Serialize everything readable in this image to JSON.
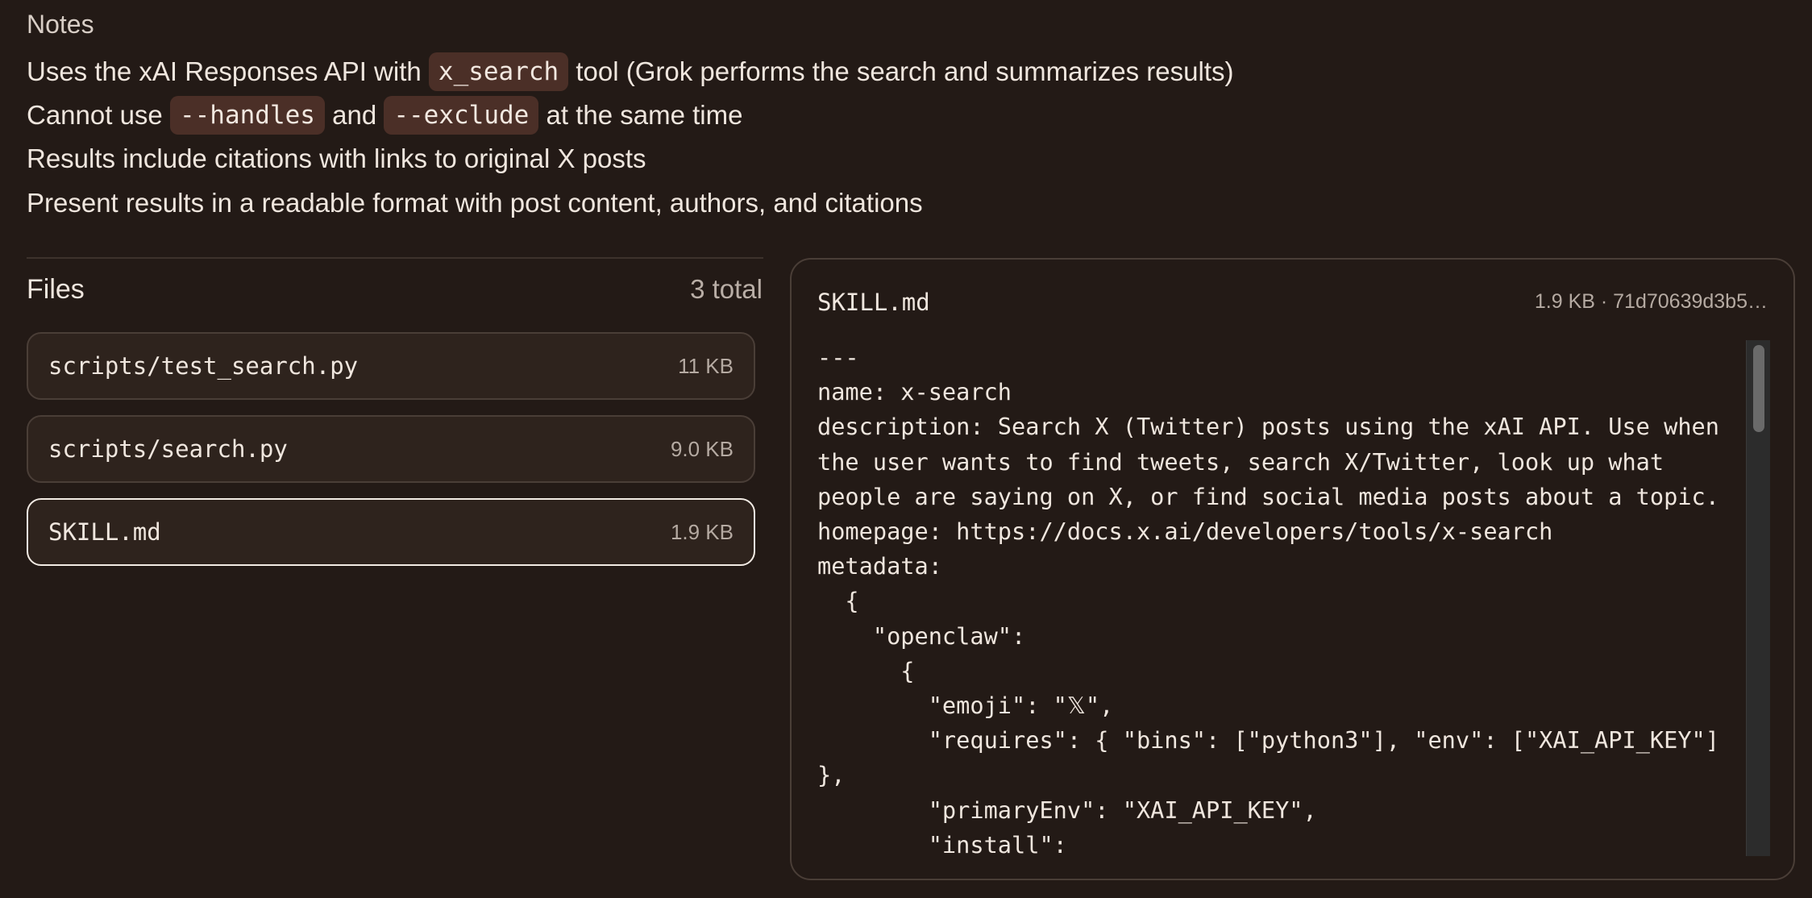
{
  "notes": {
    "title": "Notes",
    "line1": {
      "pre": "Uses the xAI Responses API with ",
      "code": "x_search",
      "post": " tool (Grok performs the search and summarizes results)"
    },
    "line2": {
      "pre": "Cannot use ",
      "code1": "--handles",
      "mid": " and ",
      "code2": "--exclude",
      "post": " at the same time"
    },
    "line3": "Results include citations with links to original X posts",
    "line4": "Present results in a readable format with post content, authors, and citations"
  },
  "files": {
    "title": "Files",
    "count": "3 total",
    "items": [
      {
        "name": "scripts/test_search.py",
        "size": "11 KB"
      },
      {
        "name": "scripts/search.py",
        "size": "9.0 KB"
      },
      {
        "name": "SKILL.md",
        "size": "1.9 KB"
      }
    ]
  },
  "viewer": {
    "filename": "SKILL.md",
    "meta": "1.9 KB · 71d70639d3b5…",
    "content": "---\nname: x-search\ndescription: Search X (Twitter) posts using the xAI API. Use when\nthe user wants to find tweets, search X/Twitter, look up what\npeople are saying on X, or find social media posts about a topic.\nhomepage: https://docs.x.ai/developers/tools/x-search\nmetadata:\n  {\n    \"openclaw\":\n      {\n        \"emoji\": \"𝕏\",\n        \"requires\": { \"bins\": [\"python3\"], \"env\": [\"XAI_API_KEY\"]\n},\n        \"primaryEnv\": \"XAI_API_KEY\",\n        \"install\":"
  }
}
